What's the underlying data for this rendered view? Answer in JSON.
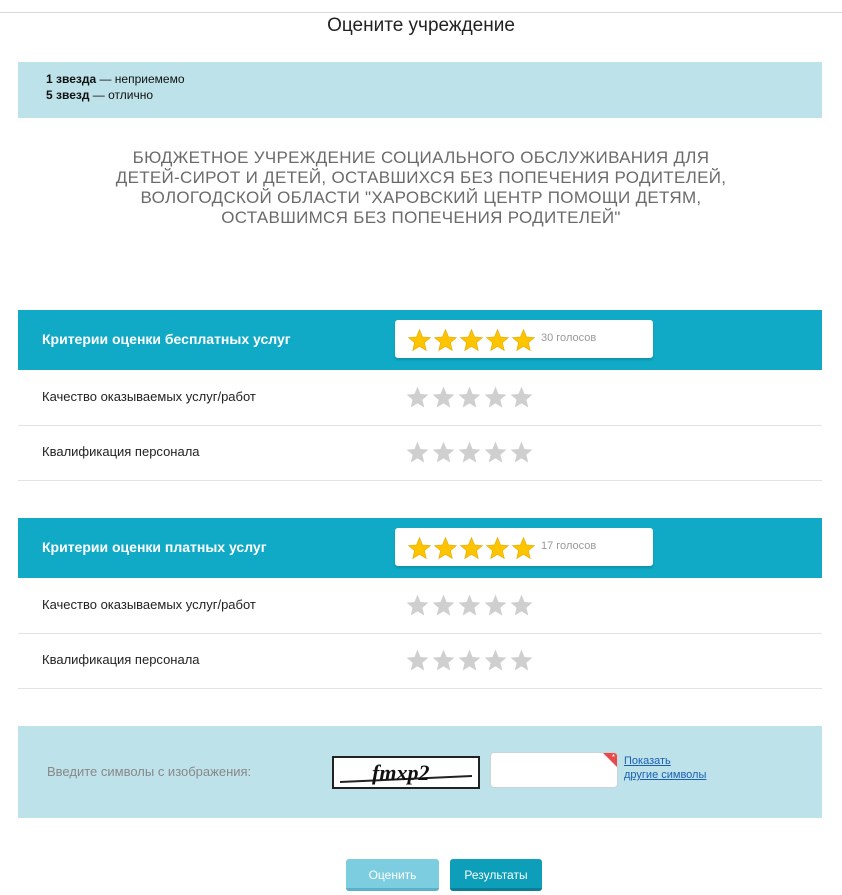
{
  "page_title": "Оцените учреждение",
  "legend": {
    "one_star_bold": "1 звезда",
    "one_star_text": " — неприемемо",
    "five_star_bold": "5 звезд",
    "five_star_text": " — отлично"
  },
  "organization": {
    "name": "БЮДЖЕТНОЕ УЧРЕЖДЕНИЕ СОЦИАЛЬНОГО ОБСЛУЖИВАНИЯ ДЛЯ ДЕТЕЙ-СИРОТ И ДЕТЕЙ, ОСТАВШИХСЯ БЕЗ ПОПЕЧЕНИЯ РОДИТЕЛЕЙ, ВОЛОГОДСКОЙ ОБЛАСТИ \"ХАРОВСКИЙ ЦЕНТР ПОМОЩИ ДЕТЯМ, ОСТАВШИМСЯ БЕЗ ПОПЕЧЕНИЯ РОДИТЕЛЕЙ\""
  },
  "sections": [
    {
      "title": "Критерии оценки бесплатных услуг",
      "rating": 5,
      "max_rating": 5,
      "votes_text": "30 голосов",
      "criteria": [
        {
          "label": "Качество оказываемых услуг/работ",
          "rating": 0
        },
        {
          "label": "Квалификация персонала",
          "rating": 0
        }
      ]
    },
    {
      "title": "Критерии оценки платных услуг",
      "rating": 5,
      "max_rating": 5,
      "votes_text": "17 голосов",
      "criteria": [
        {
          "label": "Качество оказываемых услуг/работ",
          "rating": 0
        },
        {
          "label": "Квалификация персонала",
          "rating": 0
        }
      ]
    }
  ],
  "captcha": {
    "label": "Введите символы с изображения:",
    "image_text": "fmxp2",
    "input_value": "",
    "refresh_line1": "Показать",
    "refresh_line2": "другие символы"
  },
  "buttons": {
    "rate": "Оценить",
    "results": "Результаты"
  },
  "colors": {
    "header_bg": "#10aac6",
    "panel_bg": "#bde2e9",
    "star_filled": "#ffc400",
    "star_empty": "#cfcfcf"
  }
}
